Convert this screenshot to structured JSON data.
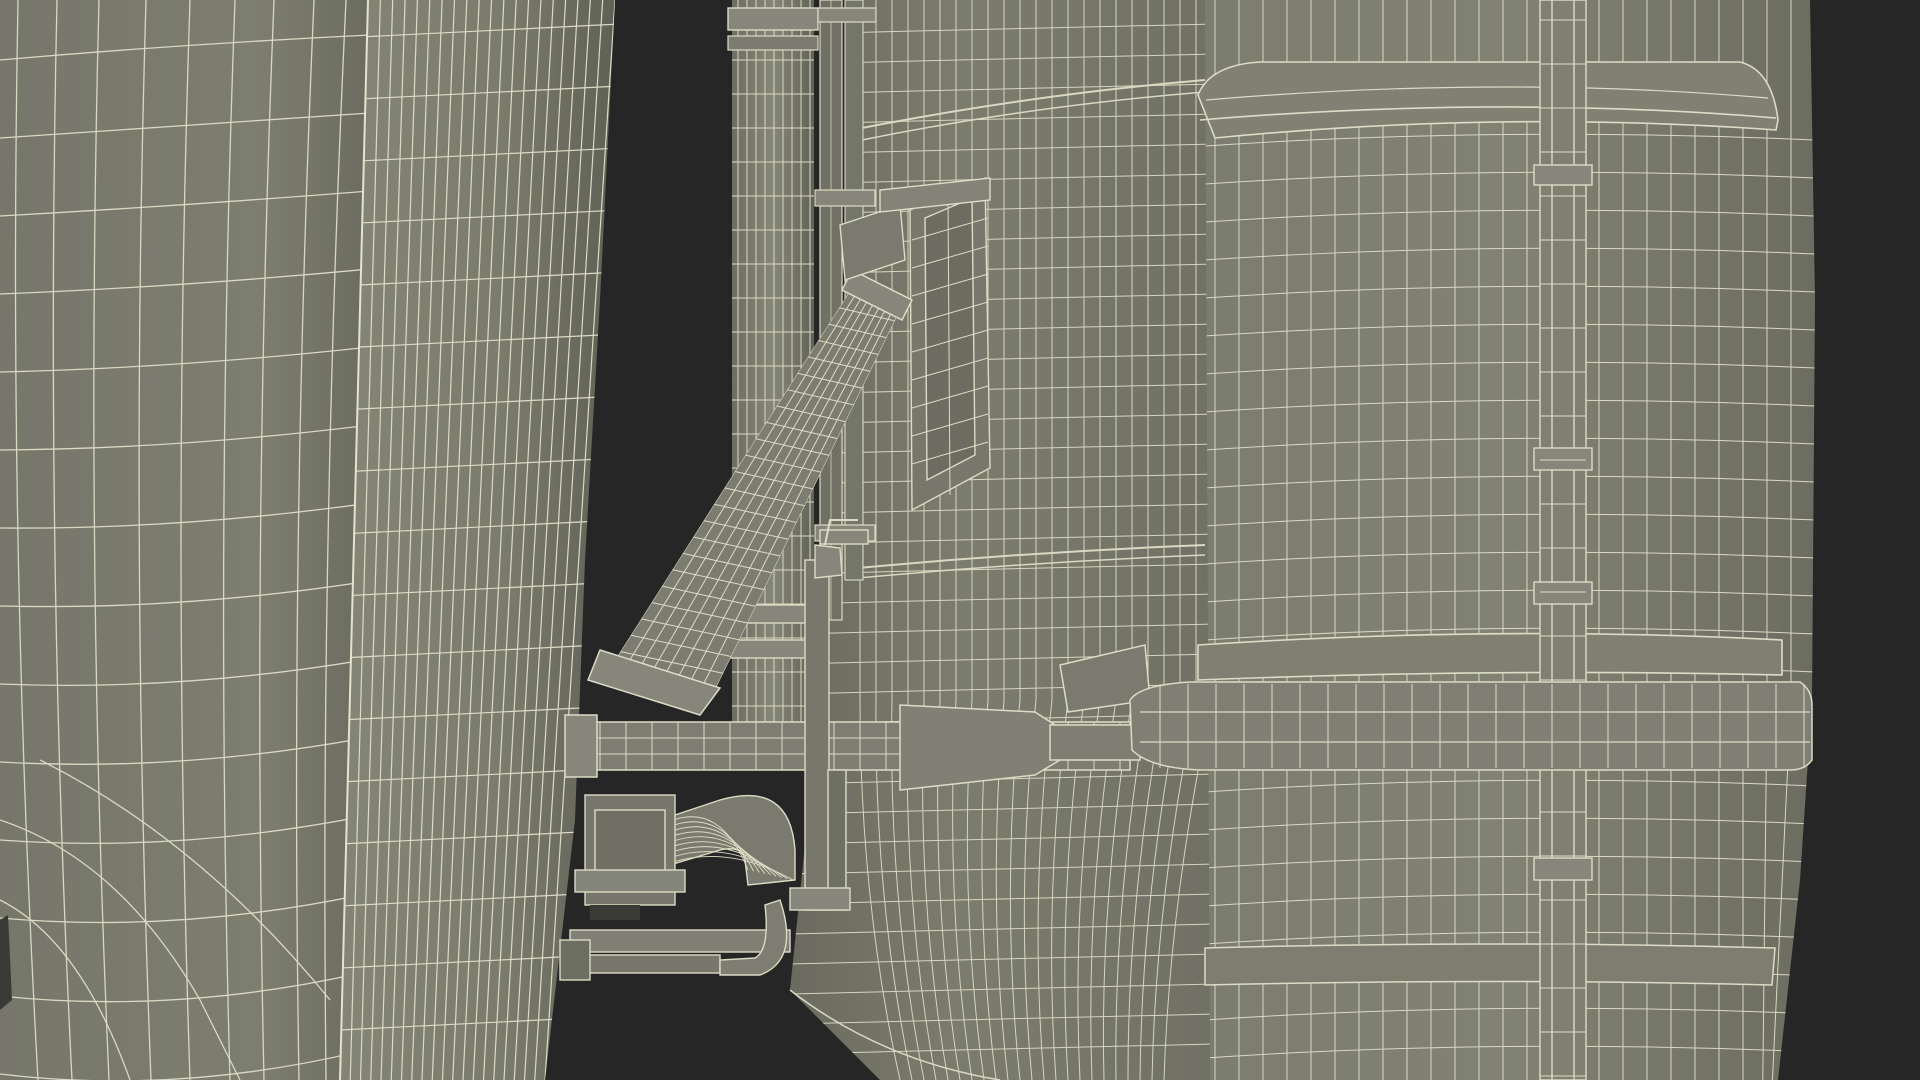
{
  "scene": {
    "subject": "wireframe-render-rocket-tank-assembly",
    "colors": {
      "background": "#262626",
      "surface": "#7a7b6c",
      "surface_light": "#838474",
      "surface_dark": "#5f6055",
      "wire": "#d9d8c2",
      "wire_dim": "#b9b8a4"
    }
  }
}
